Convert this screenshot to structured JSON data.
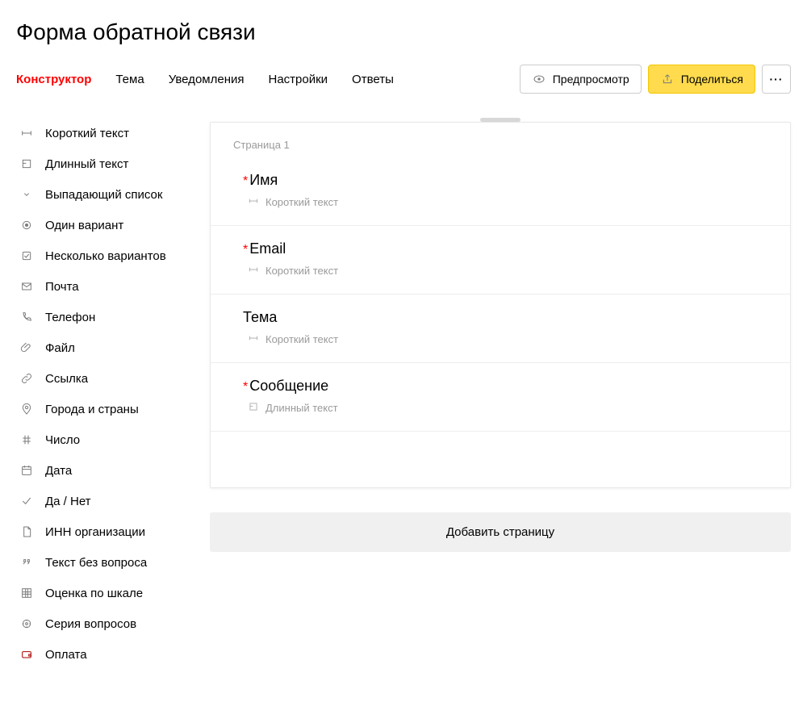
{
  "title": "Форма обратной связи",
  "tabs": {
    "constructor": "Конструктор",
    "theme": "Тема",
    "notifications": "Уведомления",
    "settings": "Настройки",
    "answers": "Ответы"
  },
  "header": {
    "preview": "Предпросмотр",
    "share": "Поделиться"
  },
  "sidebar": {
    "short_text": "Короткий текст",
    "long_text": "Длинный текст",
    "dropdown": "Выпадающий список",
    "single": "Один вариант",
    "multi": "Несколько вариантов",
    "mail": "Почта",
    "phone": "Телефон",
    "file": "Файл",
    "link": "Ссылка",
    "cities": "Города и страны",
    "number": "Число",
    "date": "Дата",
    "yesno": "Да / Нет",
    "inn": "ИНН организации",
    "noq": "Текст без вопроса",
    "scale": "Оценка по шкале",
    "series": "Серия вопросов",
    "pay": "Оплата"
  },
  "page": {
    "page_label": "Страница 1",
    "fields": {
      "0": {
        "label": "Имя",
        "type": "Короткий текст",
        "required": true
      },
      "1": {
        "label": "Email",
        "type": "Короткий текст",
        "required": true
      },
      "2": {
        "label": "Тема",
        "type": "Короткий текст",
        "required": false
      },
      "3": {
        "label": "Сообщение",
        "type": "Длинный текст",
        "required": true
      }
    },
    "add_page": "Добавить страницу"
  }
}
